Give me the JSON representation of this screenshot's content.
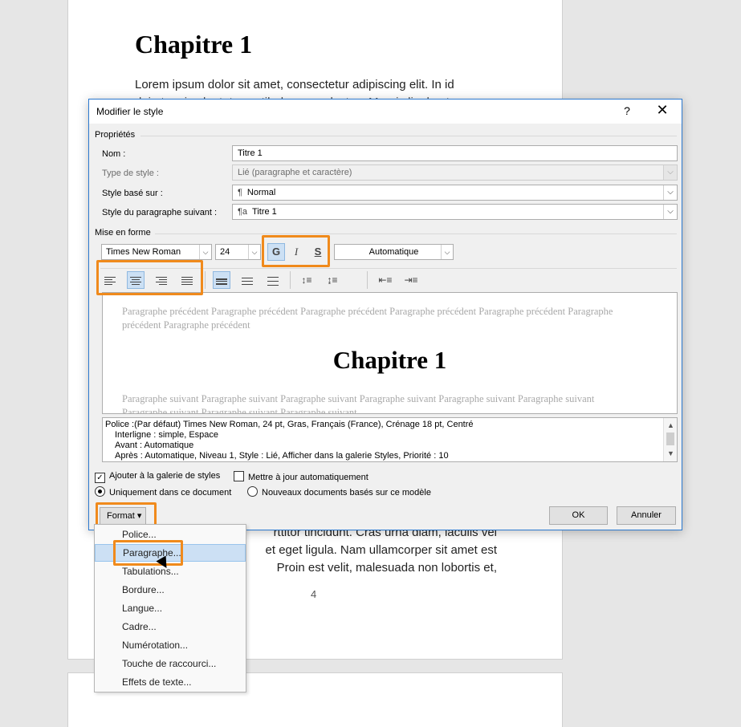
{
  "document": {
    "heading": "Chapitre 1",
    "para_line1": "Lorem ipsum dolor sit amet, consectetur adipiscing elit. In id",
    "para_line2": "dui at orci vulputate vestibulum, non lectus. Mauris ligula et",
    "tail_line1": "rttitor tincidunt. Cras urna diam, iaculis vel",
    "tail_line2": "et eget ligula. Nam ullamcorper sit amet est",
    "tail_line3": "Proin est velit, malesuada non lobortis et,",
    "page_number": "4"
  },
  "dialog": {
    "title": "Modifier le style",
    "help": "?",
    "close": "✕",
    "properties_label": "Propriétés",
    "name_label": "Nom :",
    "name_value": "Titre 1",
    "style_type_label": "Type de style :",
    "style_type_value": "Lié (paragraphe et caractère)",
    "based_on_label": "Style basé sur :",
    "based_on_value": "Normal",
    "based_on_glyph": "¶",
    "next_style_label": "Style du paragraphe suivant :",
    "next_style_value": "Titre 1",
    "next_style_glyph": "¶a",
    "format_section_label": "Mise en forme",
    "font_name": "Times New Roman",
    "font_size": "24",
    "bold": "G",
    "italic": "I",
    "underline": "S",
    "color_value": "Automatique",
    "preview_prev": "Paragraphe précédent Paragraphe précédent Paragraphe précédent Paragraphe précédent Paragraphe précédent Paragraphe précédent Paragraphe précédent",
    "preview_heading": "Chapitre 1",
    "preview_next": "Paragraphe suivant Paragraphe suivant Paragraphe suivant Paragraphe suivant Paragraphe suivant Paragraphe suivant Paragraphe suivant Paragraphe suivant Paragraphe suivant",
    "desc_line1": "Police :(Par défaut) Times New Roman, 24 pt, Gras, Français (France), Crénage 18 pt, Centré",
    "desc_line2": "Interligne : simple, Espace",
    "desc_line3": "Avant : Automatique",
    "desc_line4": "Après : Automatique, Niveau 1, Style : Lié, Afficher dans la galerie Styles, Priorité : 10",
    "add_gallery_label": "Ajouter à la galerie de styles",
    "auto_update_label": "Mettre à jour automatiquement",
    "only_document_label": "Uniquement dans ce document",
    "new_docs_label": "Nouveaux documents basés sur ce modèle",
    "format_button": "Format ▾",
    "ok_button": "OK",
    "cancel_button": "Annuler"
  },
  "format_menu": {
    "items": [
      "Police...",
      "Paragraphe...",
      "Tabulations...",
      "Bordure...",
      "Langue...",
      "Cadre...",
      "Numérotation...",
      "Touche de raccourci...",
      "Effets de texte..."
    ]
  },
  "colors": {
    "highlight": "#f08a1c",
    "dialog_border": "#2b79d0",
    "active_button": "#cce0f4"
  }
}
